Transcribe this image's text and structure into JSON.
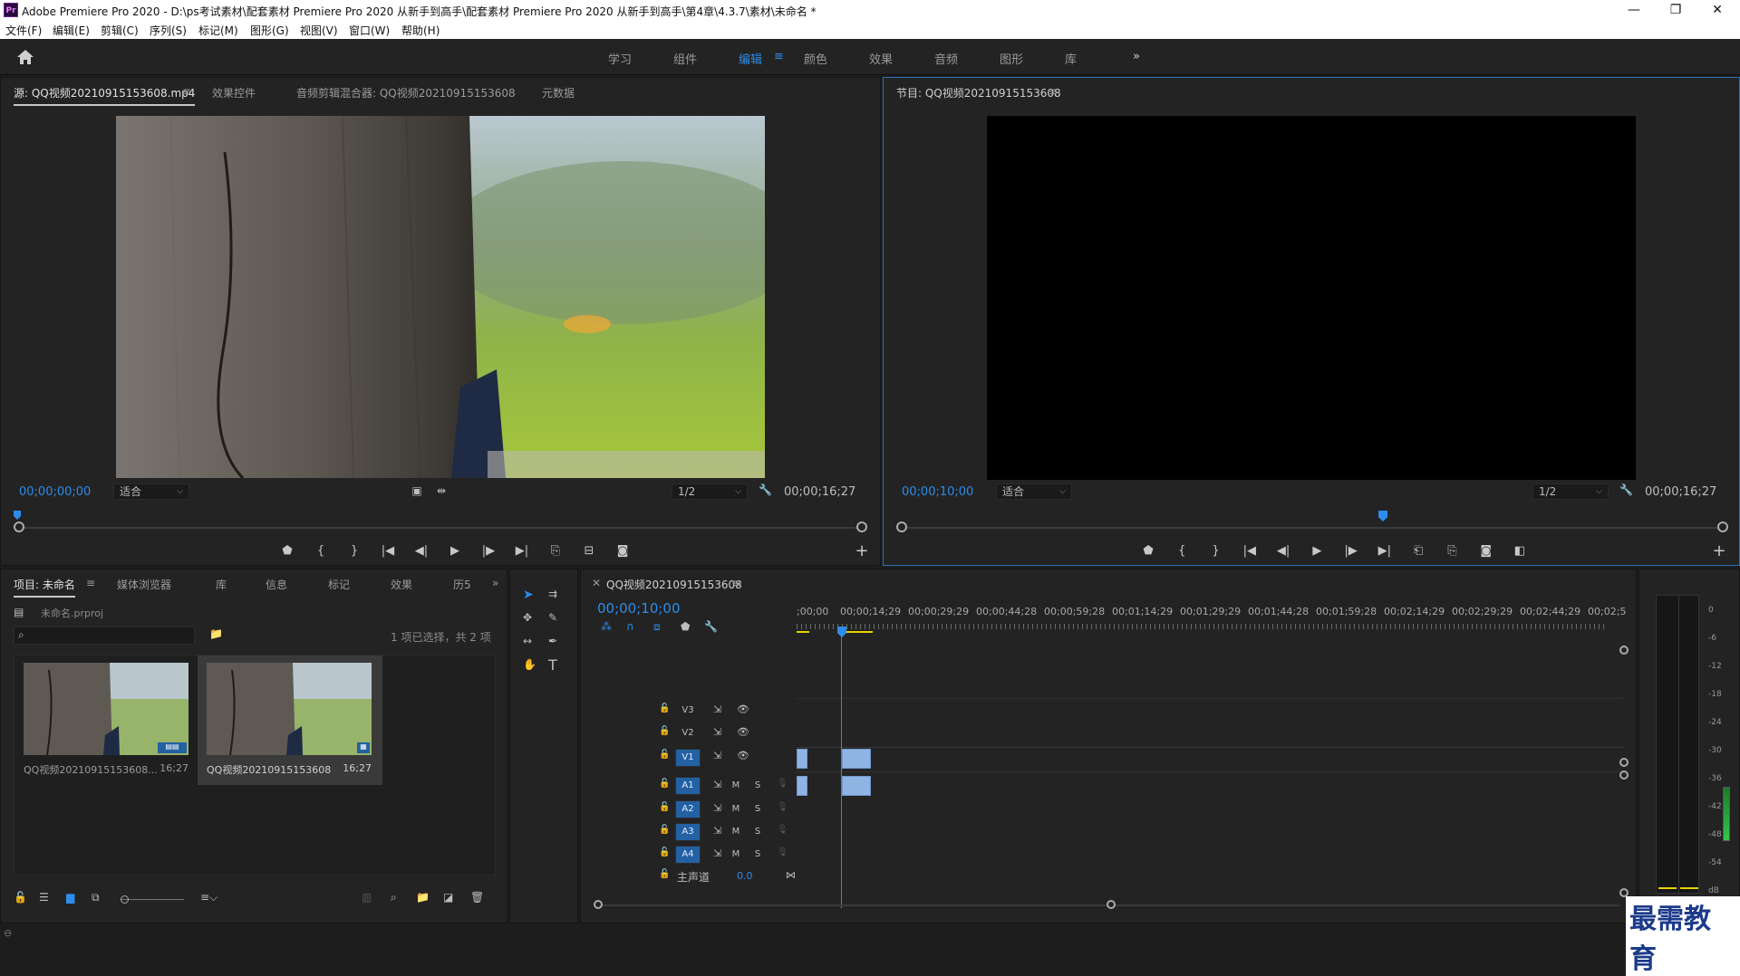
{
  "titlebar": {
    "app_icon": "Pr",
    "title": "Adobe Premiere Pro 2020 - D:\\ps考试素材\\配套素材 Premiere Pro 2020 从新手到高手\\配套素材 Premiere Pro 2020 从新手到高手\\第4章\\4.3.7\\素材\\未命名 *",
    "minimize": "—",
    "restore": "❐",
    "close": "✕"
  },
  "menubar": [
    "文件(F)",
    "编辑(E)",
    "剪辑(C)",
    "序列(S)",
    "标记(M)",
    "图形(G)",
    "视图(V)",
    "窗口(W)",
    "帮助(H)"
  ],
  "workspaces": {
    "items": [
      "学习",
      "组件",
      "编辑",
      "颜色",
      "效果",
      "音频",
      "图形",
      "库"
    ],
    "active": "编辑",
    "more": "»"
  },
  "source_panel": {
    "tabs": [
      "源: QQ视频20210915153608.mp4",
      "效果控件",
      "音频剪辑混合器: QQ视频20210915153608",
      "元数据"
    ],
    "timecode": "00;00;00;00",
    "fit": "适合",
    "resolution": "1/2",
    "duration": "00;00;16;27"
  },
  "program_panel": {
    "title": "节目: QQ视频20210915153608",
    "timecode": "00;00;10;00",
    "fit": "适合",
    "resolution": "1/2",
    "duration": "00;00;16;27"
  },
  "project_panel": {
    "tabs": [
      "项目: 未命名",
      "媒体浏览器",
      "库",
      "信息",
      "标记",
      "效果",
      "历5"
    ],
    "proj_file": "未命名.prproj",
    "search_placeholder": "",
    "selection_info": "1 项已选择，共 2 项",
    "items": [
      {
        "name": "QQ视频20210915153608...",
        "duration": "16;27"
      },
      {
        "name": "QQ视频20210915153608",
        "duration": "16;27"
      }
    ]
  },
  "timeline": {
    "tab": "QQ视频20210915153608",
    "timecode": "00;00;10;00",
    "ruler": [
      ";00;00",
      "00;00;14;29",
      "00;00;29;29",
      "00;00;44;28",
      "00;00;59;28",
      "00;01;14;29",
      "00;01;29;29",
      "00;01;44;28",
      "00;01;59;28",
      "00;02;14;29",
      "00;02;29;29",
      "00;02;44;29",
      "00;02;5"
    ],
    "video_tracks": [
      "V3",
      "V2",
      "V1"
    ],
    "audio_tracks": [
      "A1",
      "A2",
      "A3",
      "A4"
    ],
    "mute": "M",
    "solo": "S",
    "master_label": "主声道",
    "master_value": "0.0"
  },
  "meter": {
    "scale": [
      "0",
      "-6",
      "-12",
      "-18",
      "-24",
      "-30",
      "-36",
      "-42",
      "-48",
      "-54",
      "dB"
    ]
  },
  "watermark": "最需教育"
}
